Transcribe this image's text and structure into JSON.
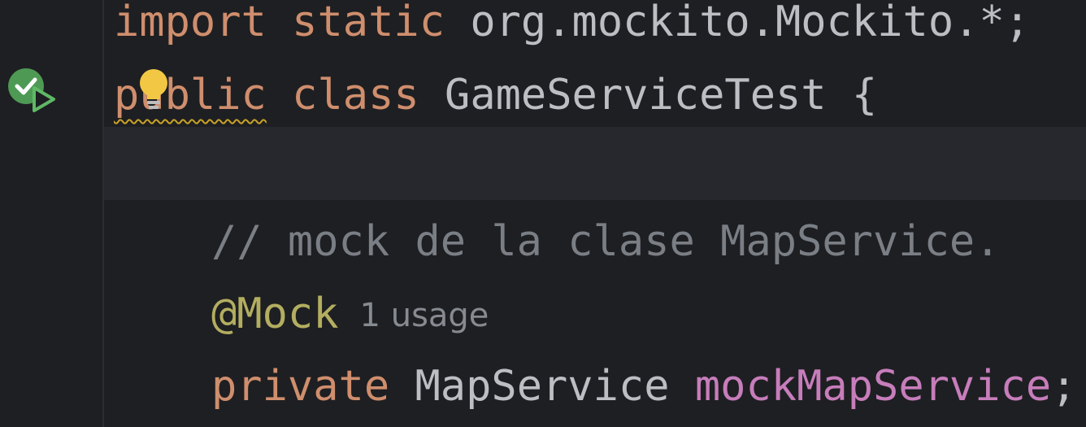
{
  "editor": {
    "lines": [
      {
        "t1": "import",
        "t2": "static",
        "t3": "org.mockito.Mockito.*;"
      },
      {
        "t1": "public",
        "t2": "class",
        "t3": "GameServiceTest {"
      },
      {
        "text": ""
      },
      {
        "comment": "// mock de la clase MapService."
      },
      {
        "annotation": "@Mock",
        "hint": "1 usage"
      },
      {
        "t1": "private",
        "t2": "MapService",
        "t3": "mockMapService",
        "t4": ";"
      }
    ]
  },
  "gutter": {
    "run_icon": "run-test-passed-icon",
    "intention_icon": "lightbulb-icon"
  },
  "colors": {
    "background": "#1e1f22",
    "keyword": "#cf8e6d",
    "plain": "#bcbec4",
    "comment": "#7a7e85",
    "annotation": "#b3ae60",
    "field": "#c77dbb",
    "current_line": "#26282e"
  }
}
